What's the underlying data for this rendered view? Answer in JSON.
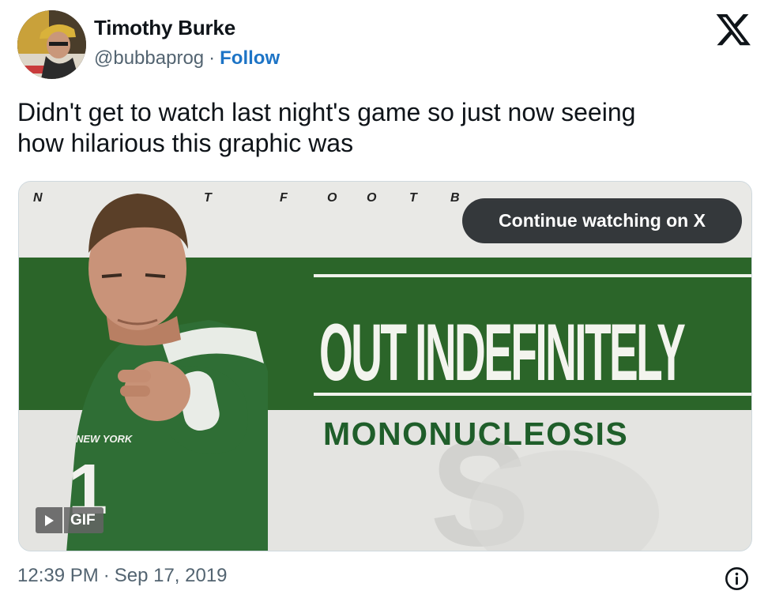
{
  "author": {
    "name": "Timothy Burke",
    "handle": "@bubbaprog",
    "separator": "·",
    "follow_label": "Follow"
  },
  "tweet": {
    "text": "Didn't get to watch last night's game so just now seeing\nhow hilarious this graphic was"
  },
  "media": {
    "top_letters": [
      "N",
      "T",
      "F",
      "O",
      "O",
      "T",
      "B"
    ],
    "headline": "OUT INDEFINITELY",
    "subhead": "MONONUCLEOSIS",
    "continue_label": "Continue watching on X",
    "gif_label": "GIF",
    "jersey_text": "NEW YORK",
    "jersey_number": "1",
    "watermark_letter": "S",
    "colors": {
      "banner_green": "#2e6a2d",
      "jersey_green": "#2f6e35",
      "subhead_green": "#1f5e2a",
      "background": "#e4e4e1"
    }
  },
  "footer": {
    "time": "12:39 PM",
    "separator": "·",
    "date": "Sep 17, 2019"
  },
  "icons": {
    "brand": "x-logo-icon",
    "info": "info-icon",
    "play": "play-icon"
  },
  "accent_color": "#1d74c6"
}
